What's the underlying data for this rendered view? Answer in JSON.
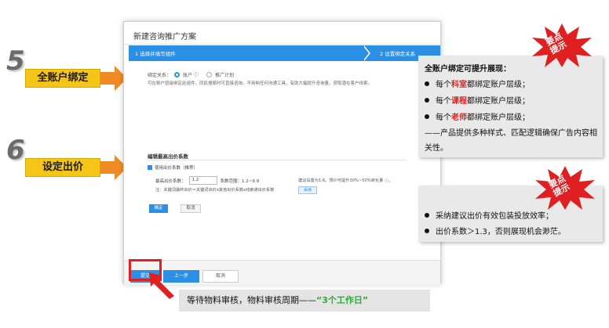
{
  "dialog": {
    "title": "新建咨询推广方案",
    "step1": "1 选择并填写组件",
    "step2": "2 设置绑定关系",
    "bind_label": "绑定关系：",
    "bind_option1": "账户 ⓘ",
    "bind_option2": "推广计划",
    "bind_note": "可在账户层级绑定此组件，同民搜索时可直接咨询，不用制任何沟通工具，有助大幅提升咨询量，获取潜在客户线索。",
    "section_title": "编辑最高出价系数",
    "checkbox_label": "使用出价系数（推荐）",
    "coef_label": "最高出价系数：",
    "coef_value": "1.2",
    "coef_range": "系数范围：1.2~9.9",
    "coef_note": "注：关键词最终出价＝关键词出价x其他出价系数x线索通出价系数",
    "suggest_text": "建议设置为1.6。预计可提升30%~50%转化量 ⓘ。",
    "adopt_label": "采纳",
    "ok_label": "确定",
    "cancel_small_label": "取消",
    "submit_label": "提交",
    "prev_label": "上一步",
    "cancel_label": "取消"
  },
  "annotations": {
    "step5_num": "5",
    "step5_label": "全账户绑定",
    "step6_num": "6",
    "step6_label": "设定出价",
    "burst_text_line1": "要点",
    "burst_text_line2": "提示",
    "panel1": {
      "head": "全账户绑定可提升展现：",
      "items": [
        {
          "pre": "每个",
          "red": "科室",
          "post": "都绑定账户层级；"
        },
        {
          "pre": "每个",
          "red": "课程",
          "post": "都绑定账户层级；"
        },
        {
          "pre": "每个",
          "red": "老师",
          "post": "都绑定账户层级；"
        }
      ],
      "note": "——产品提供多种样式、匹配逻辑确保广告内容相关性。"
    },
    "panel2": {
      "items": [
        "采纳建议出价有效包装投放效率；",
        "出价系数＞1.3，否则展现机会渺茫。"
      ]
    },
    "bottom_note_pre": "等待物料审核，物料审核周期——",
    "bottom_note_green": "“3个工作日”"
  },
  "colors": {
    "primary_blue": "#2b8fe6",
    "highlight_red": "#e02020",
    "label_yellow": "#f5c518",
    "arrow_orange": "#f08a24",
    "green": "#2eaa3a"
  }
}
